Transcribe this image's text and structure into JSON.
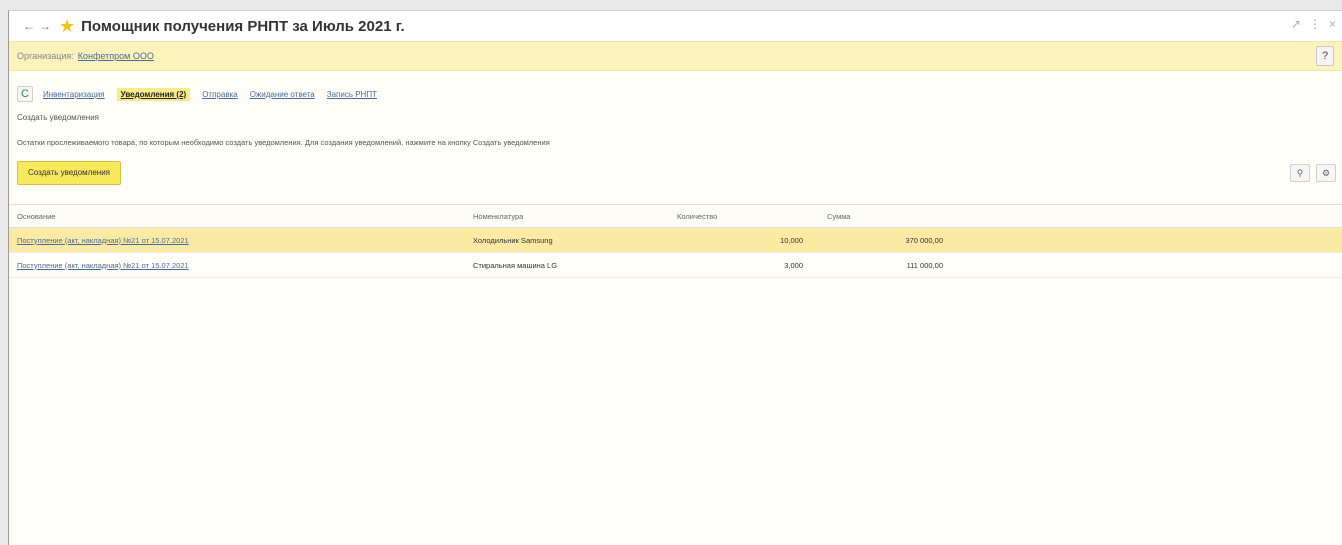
{
  "window": {
    "title": "Помощник получения РНПТ за Июль 2021 г.",
    "back_icon": "arrow-left",
    "forward_icon": "arrow-right",
    "favorite_icon": "star"
  },
  "org": {
    "label": "Организация:",
    "value": "Конфетпром ООО",
    "help_label": "?"
  },
  "tabs": [
    {
      "label": "Инвентаризация",
      "active": false
    },
    {
      "label": "Уведомления (2)",
      "active": true
    },
    {
      "label": "Отправка",
      "active": false
    },
    {
      "label": "Ожидание ответа",
      "active": false
    },
    {
      "label": "Запись РНПТ",
      "active": false
    }
  ],
  "refresh_label": "C",
  "heading": "Создать уведомления",
  "description": "Остатки прослеживаемого товара, по которым необходимо создать уведомления. Для создания уведомлений, нажмите на кнопку Создать уведомления",
  "toolbar": {
    "create_label": "Создать уведомления"
  },
  "table": {
    "columns": [
      "Основание",
      "Номенклатура",
      "Количество",
      "Сумма"
    ],
    "rows": [
      {
        "basis": "Поступление (акт, накладная) №21 от 15.07.2021",
        "item": "Холодильник Samsung",
        "qty": "10,000",
        "sum": "370 000,00"
      },
      {
        "basis": "Поступление (акт, накладная) №21 от 15.07.2021",
        "item": "Стиральная машина LG",
        "qty": "3,000",
        "sum": "111 000,00"
      }
    ]
  },
  "colors": {
    "accent_yellow": "#f7e85c",
    "org_bar": "#fbf2bc",
    "selected_row": "#fbeaa4",
    "link": "#4a6a9a"
  }
}
